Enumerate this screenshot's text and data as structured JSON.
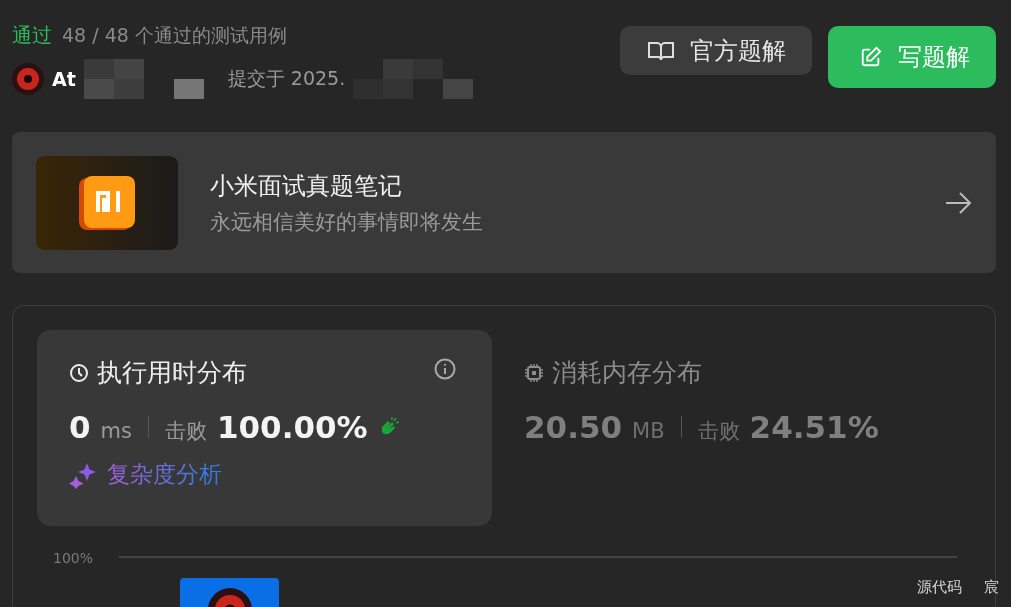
{
  "status": {
    "label": "通过",
    "detail": "48 / 48 个通过的测试用例"
  },
  "submission": {
    "author": "At",
    "submitted": "提交于 2025."
  },
  "actions": [
    {
      "label": "官方题解",
      "kind": "secondary"
    },
    {
      "label": "写题解",
      "kind": "primary"
    }
  ],
  "promo": {
    "title": "小米面试真题笔记",
    "subtitle": "永远相信美好的事情即将发生"
  },
  "metrics": [
    {
      "kind": "runtime",
      "title": "执行用时分布",
      "value": "0",
      "unit": "ms",
      "beat_label": "击败",
      "beat": "100.00%",
      "selected": true
    },
    {
      "kind": "memory",
      "title": "消耗内存分布",
      "value": "20.50",
      "unit": "MB",
      "beat_label": "击败",
      "beat": "24.51%",
      "selected": false
    }
  ],
  "analysis_link": "复杂度分析",
  "chart": {
    "tick": "100%"
  },
  "floating_labels": [
    "源代码",
    "宸"
  ]
}
